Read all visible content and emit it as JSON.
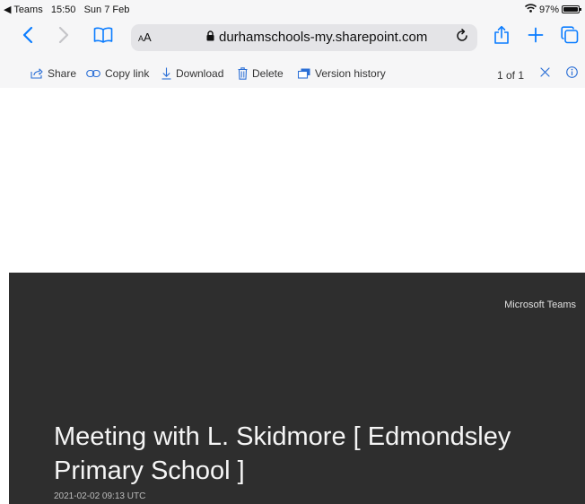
{
  "status_bar": {
    "back_app": "◀ Teams",
    "time": "15:50",
    "date": "Sun 7 Feb",
    "battery": "97%"
  },
  "browser": {
    "text_size_label": "AA",
    "url": "durhamschools-my.sharepoint.com"
  },
  "actions": {
    "share": "Share",
    "copy_link": "Copy link",
    "download": "Download",
    "delete": "Delete",
    "version_history": "Version history",
    "pager": "1 of 1"
  },
  "preview": {
    "brand": "Microsoft Teams",
    "title": "Meeting with L. Skidmore [ Edmondsley Primary School ]",
    "date": "2021-02-02 09:13 UTC"
  },
  "colors": {
    "accent": "#0a7cff",
    "sp_blue": "#2b6fd6",
    "preview_bg": "#2e2e2e"
  },
  "icons": {
    "back": "chevron-left-icon",
    "forward": "chevron-right-icon",
    "bookmarks": "book-icon",
    "lock": "lock-icon",
    "reload": "reload-icon",
    "share_sheet": "share-icon",
    "new_tab": "plus-icon",
    "tabs": "tabs-icon",
    "wifi": "wifi-icon",
    "battery": "battery-icon"
  }
}
